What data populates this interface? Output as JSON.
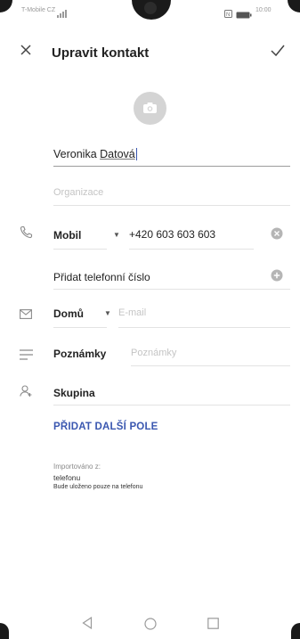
{
  "status_bar": {
    "carrier": "T-Mobile CZ",
    "time": "10:00"
  },
  "header": {
    "title": "Upravit kontakt"
  },
  "form": {
    "name_first": "Veronika ",
    "name_last": "Datová",
    "organization_placeholder": "Organizace",
    "phone": {
      "type_label": "Mobil",
      "number": "+420 603 603 603"
    },
    "add_phone_label": "Přidat telefonní číslo",
    "email": {
      "type_label": "Domů",
      "placeholder": "E-mail"
    },
    "notes": {
      "label": "Poznámky",
      "placeholder": "Poznámky"
    },
    "group": {
      "label": "Skupina"
    },
    "add_field_label": "PŘIDAT DALŠÍ POLE"
  },
  "import_info": {
    "label": "Importováno z:",
    "source": "telefonu",
    "note": "Bude uloženo pouze na telefonu"
  }
}
